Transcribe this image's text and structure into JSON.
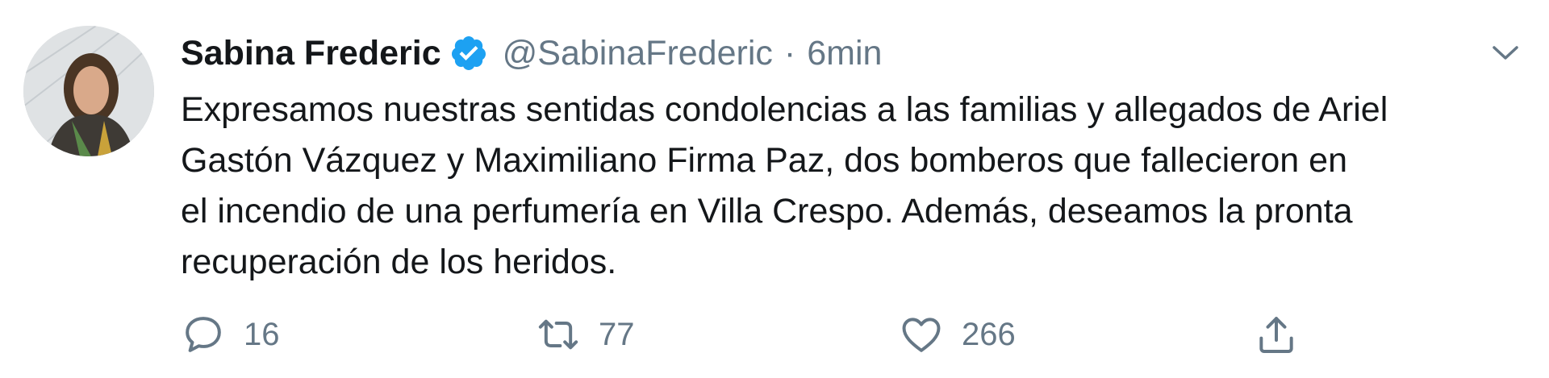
{
  "tweet": {
    "author": {
      "name": "Sabina Frederic",
      "handle": "@SabinaFrederic",
      "verified": true,
      "avatar_icon": "profile-photo"
    },
    "separator": "·",
    "time": "6min",
    "text_lines": [
      "Expresamos nuestras sentidas condolencias a las familias y allegados de Ariel",
      "Gastón Vázquez y Maximiliano Firma Paz, dos bomberos que fallecieron en",
      "el incendio de una perfumería en Villa Crespo. Además, deseamos la pronta",
      "recuperación de los heridos."
    ],
    "actions": {
      "reply": {
        "icon": "reply-icon",
        "count": "16"
      },
      "retweet": {
        "icon": "retweet-icon",
        "count": "77"
      },
      "like": {
        "icon": "heart-icon",
        "count": "266"
      },
      "share": {
        "icon": "share-icon"
      }
    },
    "menu_icon": "chevron-down-icon"
  },
  "colors": {
    "text": "#14171a",
    "secondary": "#657786",
    "verified_blue": "#1da1f2"
  }
}
